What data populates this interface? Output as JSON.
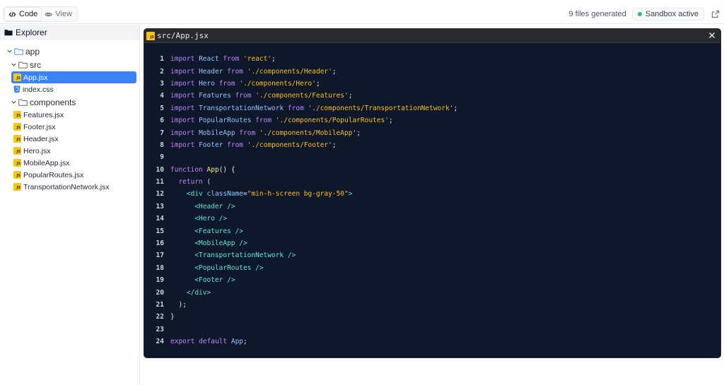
{
  "topbar": {
    "code_label": "Code",
    "view_label": "View",
    "files_generated": "9 files generated",
    "sandbox_status": "Sandbox active",
    "status_color": "#22c55e"
  },
  "sidebar": {
    "title": "Explorer",
    "tree": {
      "root": "app",
      "src": "src",
      "src_files": [
        "App.jsx",
        "index.css"
      ],
      "components": "components",
      "component_files": [
        "Features.jsx",
        "Footer.jsx",
        "Header.jsx",
        "Hero.jsx",
        "MobileApp.jsx",
        "PopularRoutes.jsx",
        "TransportationNetwork.jsx"
      ]
    },
    "selected_file": "App.jsx",
    "selection_color": "#3b82f6"
  },
  "editor": {
    "tab_title": "src/App.jsx",
    "js_badge": "JS",
    "lines": [
      "import React from 'react';",
      "import Header from './components/Header';",
      "import Hero from './components/Hero';",
      "import Features from './components/Features';",
      "import TransportationNetwork from './components/TransportationNetwork';",
      "import PopularRoutes from './components/PopularRoutes';",
      "import MobileApp from './components/MobileApp';",
      "import Footer from './components/Footer';",
      "",
      "function App() {",
      "  return (",
      "    <div className=\"min-h-screen bg-gray-50\">",
      "      <Header />",
      "      <Hero />",
      "      <Features />",
      "      <MobileApp />",
      "      <TransportationNetwork />",
      "      <PopularRoutes />",
      "      <Footer />",
      "    </div>",
      "  );",
      "}",
      "",
      "export default App;"
    ]
  }
}
